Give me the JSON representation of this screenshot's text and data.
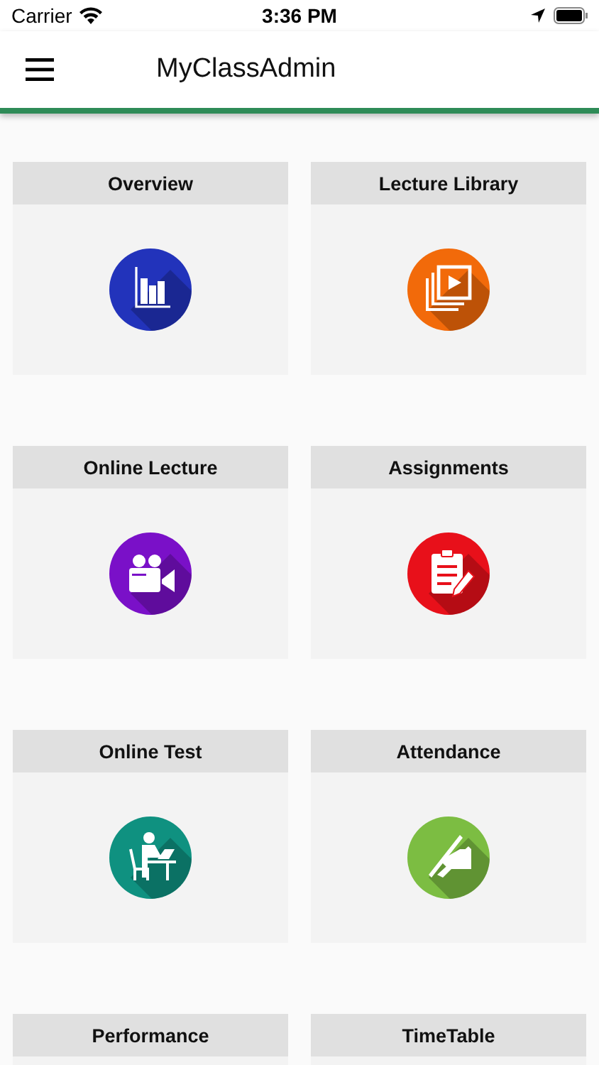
{
  "status_bar": {
    "carrier": "Carrier",
    "time": "3:36 PM"
  },
  "app_bar": {
    "title": "MyClassAdmin"
  },
  "tiles": [
    {
      "label": "Overview",
      "color": "#2233bb"
    },
    {
      "label": "Lecture Library",
      "color": "#f26a0a"
    },
    {
      "label": "Online Lecture",
      "color": "#7a10c8"
    },
    {
      "label": "Assignments",
      "color": "#e8101a"
    },
    {
      "label": "Online Test",
      "color": "#0f9180"
    },
    {
      "label": "Attendance",
      "color": "#7cbd42"
    },
    {
      "label": "Performance"
    },
    {
      "label": "TimeTable"
    }
  ]
}
